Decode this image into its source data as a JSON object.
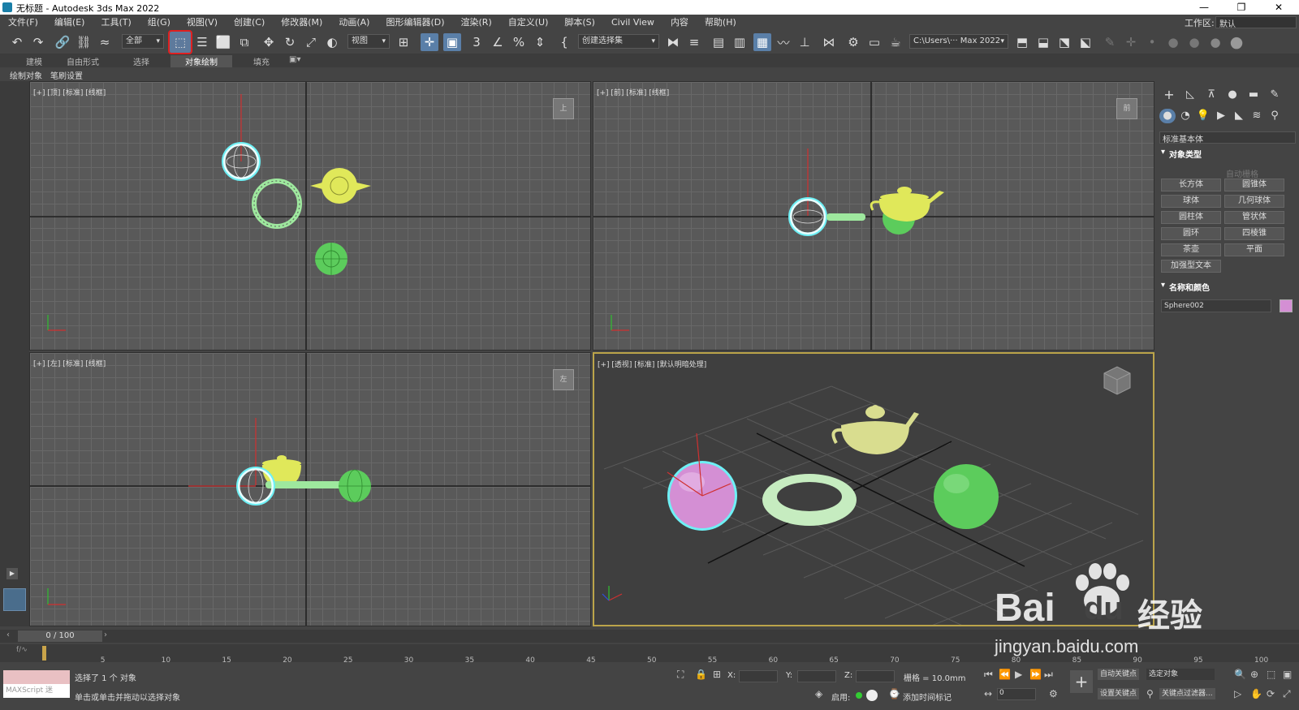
{
  "window": {
    "title": "无标题 - Autodesk 3ds Max 2022",
    "min": "—",
    "max": "❐",
    "close": "✕"
  },
  "menu": {
    "items": [
      "文件(F)",
      "编辑(E)",
      "工具(T)",
      "组(G)",
      "视图(V)",
      "创建(C)",
      "修改器(M)",
      "动画(A)",
      "图形编辑器(D)",
      "渲染(R)",
      "自定义(U)",
      "脚本(S)",
      "Civil View",
      "内容",
      "帮助(H)"
    ],
    "workspace_label": "工作区:",
    "workspace_value": "默认"
  },
  "toolbar": {
    "filter": "全部",
    "refcoord": "视图",
    "selset": "创建选择集",
    "path": "C:\\Users\\··· Max 2022"
  },
  "ribbon": {
    "tabs": [
      "建模",
      "自由形式",
      "选择",
      "对象绘制",
      "填充"
    ],
    "active": "对象绘制",
    "subtabs": [
      "绘制对象",
      "笔刷设置"
    ]
  },
  "viewports": {
    "top": {
      "label": "[+] [顶] [标准] [线框]",
      "cube": "上"
    },
    "front": {
      "label": "[+] [前] [标准] [线框]",
      "cube": "前"
    },
    "left": {
      "label": "[+] [左] [标准] [线框]",
      "cube": "左"
    },
    "persp": {
      "label": "[+] [透视] [标准] [默认明暗处理]"
    }
  },
  "command_panel": {
    "category": "标准基本体",
    "object_type": {
      "title": "对象类型",
      "autogrid": "自动栅格",
      "buttons": [
        "长方体",
        "圆锥体",
        "球体",
        "几何球体",
        "圆柱体",
        "管状体",
        "圆环",
        "四棱锥",
        "茶壶",
        "平面",
        "加强型文本"
      ]
    },
    "name_color": {
      "title": "名称和颜色",
      "name": "Sphere002",
      "color": "#d48fd4"
    }
  },
  "timeline": {
    "frame": "0 / 100",
    "ticks": [
      "5",
      "10",
      "15",
      "20",
      "25",
      "30",
      "35",
      "40",
      "45",
      "50",
      "55",
      "60",
      "65",
      "70",
      "75",
      "80",
      "85",
      "90",
      "95",
      "100"
    ]
  },
  "status": {
    "maxscript": "MAXScript 迷",
    "selected": "选择了 1 个 对象",
    "prompt": "单击或单击并拖动以选择对象",
    "x": "X:",
    "y": "Y:",
    "z": "Z:",
    "grid": "栅格 = 10.0mm",
    "enable": "启用:",
    "addtime": "添加时间标记",
    "autokey": "自动关键点",
    "selobj": "选定对象",
    "setkey": "设置关键点",
    "keyfilter": "关键点过滤器...",
    "frame_field": "0"
  },
  "watermark": {
    "brand": "Bai",
    "du": "du",
    "cn": "经验",
    "url": "jingyan.baidu.com"
  },
  "colors": {
    "selected": "#6ef0f5",
    "torus": "#9ee89e",
    "teapot": "#e0e85a",
    "sphere": "#5ccc5c",
    "persp_sphere": "#d48fd4"
  }
}
